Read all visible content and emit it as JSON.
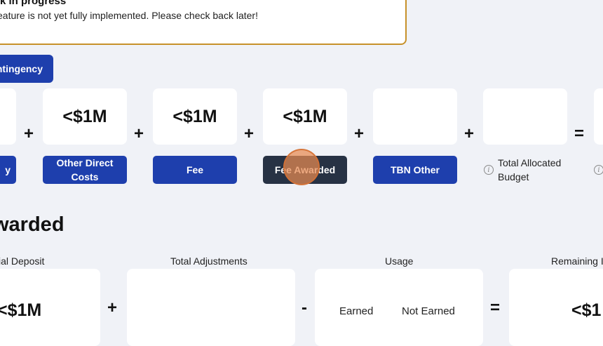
{
  "banner": {
    "title": "k in progress",
    "message": "eature is not yet fully implemented. Please check back later!"
  },
  "contingency_button": "ntingency",
  "budget": {
    "values": [
      "",
      "<$1M",
      "<$1M",
      "<$1M",
      "",
      ""
    ],
    "operators": [
      "+",
      "+",
      "+",
      "+",
      "+",
      "="
    ],
    "labels": [
      "y",
      "Other Direct Costs",
      "Fee",
      "Fee Awarded",
      "TBN Other"
    ],
    "total_label": "Total Allocated Budget"
  },
  "fee_awarded": {
    "title": "warded",
    "headers": {
      "initial_deposit": "ial Deposit",
      "total_adjustments": "Total Adjustments",
      "usage": "Usage",
      "remaining": "Remaining I"
    },
    "initial_deposit_value": "<$1M",
    "remaining_value": "<$1",
    "operators": [
      "+",
      "-",
      "="
    ],
    "usage_earned": "Earned",
    "usage_not_earned": "Not Earned"
  }
}
